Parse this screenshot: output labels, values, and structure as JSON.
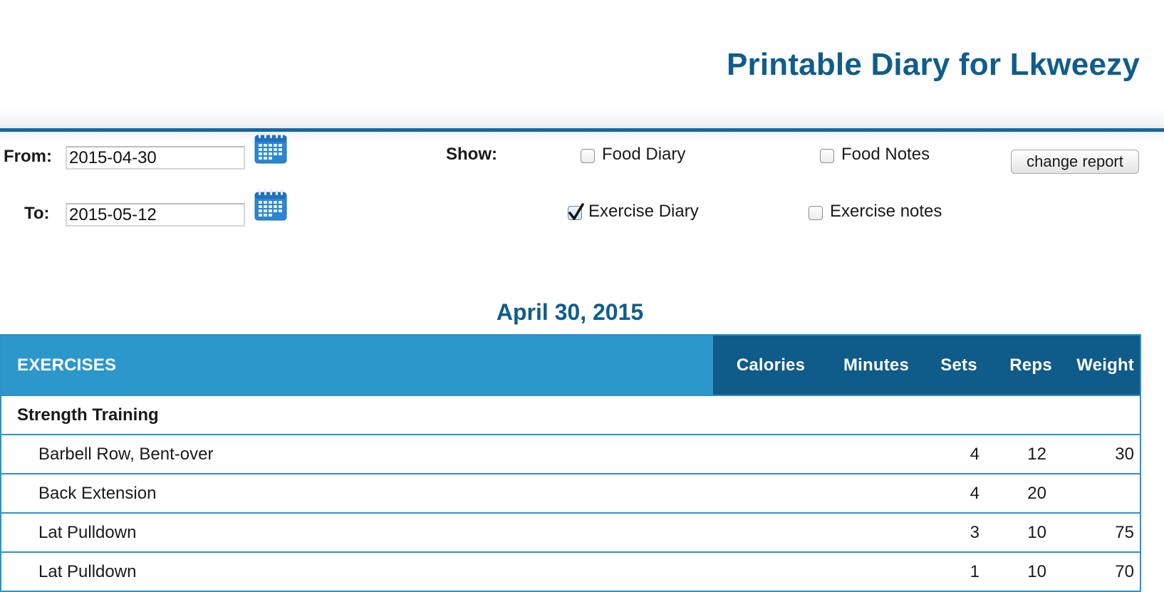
{
  "page": {
    "title": "Printable Diary for Lkweezy"
  },
  "controls": {
    "from_label": "From:",
    "from_value": "2015-04-30",
    "to_label": "To:",
    "to_value": "2015-05-12",
    "calendar_icon": "calendar-icon",
    "show_label": "Show:",
    "options": [
      {
        "label": "Food Diary",
        "checked": false
      },
      {
        "label": "Food Notes",
        "checked": false
      },
      {
        "label": "Exercise Diary",
        "checked": true
      },
      {
        "label": "Exercise notes",
        "checked": false
      }
    ],
    "change_button": "change report"
  },
  "report": {
    "date": "April 30, 2015",
    "columns": [
      "EXERCISES",
      "Calories",
      "Minutes",
      "Sets",
      "Reps",
      "Weight"
    ],
    "category": "Strength Training",
    "rows": [
      {
        "name": "Barbell Row, Bent-over",
        "calories": "",
        "minutes": "",
        "sets": "4",
        "reps": "12",
        "weight": "30"
      },
      {
        "name": "Back Extension",
        "calories": "",
        "minutes": "",
        "sets": "4",
        "reps": "20",
        "weight": ""
      },
      {
        "name": "Lat Pulldown",
        "calories": "",
        "minutes": "",
        "sets": "3",
        "reps": "10",
        "weight": "75"
      },
      {
        "name": "Lat Pulldown",
        "calories": "",
        "minutes": "",
        "sets": "1",
        "reps": "10",
        "weight": "70"
      }
    ]
  },
  "colors": {
    "title": "#0f5d8c",
    "header_rule": "#1566a0",
    "table_header": "#2c97cb",
    "table_header_dark": "#0f5b8a",
    "table_border": "#2c92c9"
  }
}
